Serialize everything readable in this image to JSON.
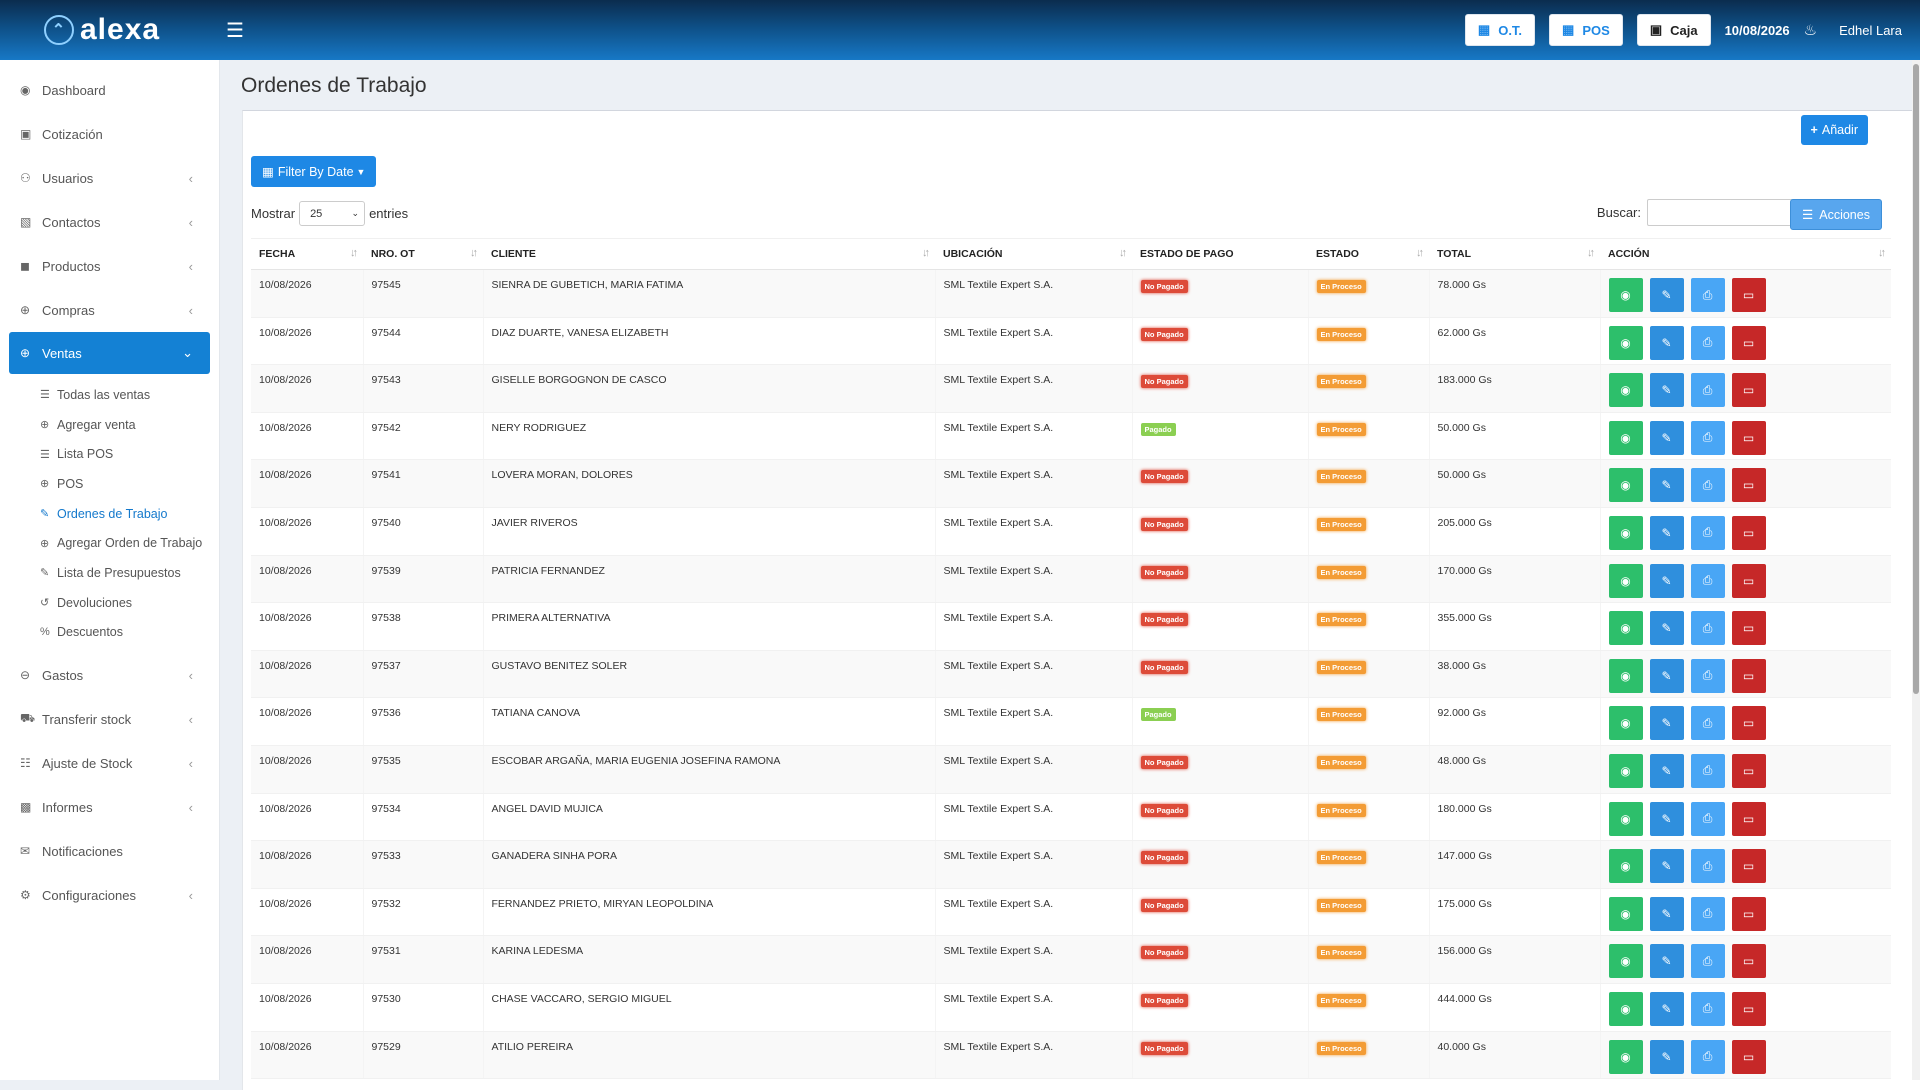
{
  "header": {
    "brand": "alexa",
    "buttons": [
      {
        "label": "O.T.",
        "icon": "grid-icon"
      },
      {
        "label": "POS",
        "icon": "grid-icon"
      },
      {
        "label": "Caja",
        "icon": "cash-icon"
      }
    ],
    "date": "10/08/2026",
    "user": "Edhel Lara"
  },
  "sidebar": {
    "items": [
      {
        "label": "Dashboard",
        "icon": "dashboard-icon"
      },
      {
        "label": "Cotización",
        "icon": "money-icon"
      },
      {
        "label": "Usuarios",
        "icon": "users-icon"
      },
      {
        "label": "Contactos",
        "icon": "contacts-icon"
      },
      {
        "label": "Productos",
        "icon": "cubes-icon"
      },
      {
        "label": "Compras",
        "icon": "plus-circle-icon"
      },
      {
        "label": "Ventas",
        "icon": "plus-circle-icon"
      },
      {
        "label": "Gastos",
        "icon": "minus-circle-icon"
      },
      {
        "label": "Transferir stock",
        "icon": "truck-icon"
      },
      {
        "label": "Ajuste de Stock",
        "icon": "database-icon"
      },
      {
        "label": "Informes",
        "icon": "bar-chart-icon"
      },
      {
        "label": "Notificaciones",
        "icon": "envelope-icon"
      },
      {
        "label": "Configuraciones",
        "icon": "gear-icon"
      }
    ],
    "ventas_sub": [
      {
        "label": "Todas las ventas",
        "icon": "list-icon"
      },
      {
        "label": "Agregar venta",
        "icon": "plus-circle-icon"
      },
      {
        "label": "Lista POS",
        "icon": "list-icon"
      },
      {
        "label": "POS",
        "icon": "plus-circle-icon"
      },
      {
        "label": "Ordenes de Trabajo",
        "icon": "edit-icon"
      },
      {
        "label": "Agregar Orden de Trabajo",
        "icon": "plus-circle-icon"
      },
      {
        "label": "Lista de Presupuestos",
        "icon": "edit-icon"
      },
      {
        "label": "Devoluciones",
        "icon": "undo-icon"
      },
      {
        "label": "Descuentos",
        "icon": "percent-icon"
      }
    ]
  },
  "page": {
    "title": "Ordenes de Trabajo",
    "add_label": "Añadir",
    "filter_label": "Filter By Date",
    "show_label": "Mostrar",
    "entries_value": "25",
    "entries_label": "entries",
    "search_label": "Buscar:",
    "search_value": "",
    "actions_label": "Acciones"
  },
  "table": {
    "headers": [
      "Fecha",
      "Nro. OT",
      "Cliente",
      "Ubicación",
      "Estado de pago",
      "Estado",
      "Total",
      "Acción"
    ],
    "rows": [
      [
        "10/08/2026",
        "97545",
        "SIENRA DE GUBETICH, MARIA FATIMA",
        "SML Textile Expert S.A.",
        "No Pagado",
        "En Proceso",
        "78.000 Gs"
      ],
      [
        "10/08/2026",
        "97544",
        "DIAZ DUARTE, VANESA ELIZABETH",
        "SML Textile Expert S.A.",
        "No Pagado",
        "En Proceso",
        "62.000 Gs"
      ],
      [
        "10/08/2026",
        "97543",
        "GISELLE BORGOGNON DE CASCO",
        "SML Textile Expert S.A.",
        "No Pagado",
        "En Proceso",
        "183.000 Gs"
      ],
      [
        "10/08/2026",
        "97542",
        "NERY RODRIGUEZ",
        "SML Textile Expert S.A.",
        "Pagado",
        "En Proceso",
        "50.000 Gs"
      ],
      [
        "10/08/2026",
        "97541",
        "LOVERA MORAN, DOLORES",
        "SML Textile Expert S.A.",
        "No Pagado",
        "En Proceso",
        "50.000 Gs"
      ],
      [
        "10/08/2026",
        "97540",
        "JAVIER RIVEROS",
        "SML Textile Expert S.A.",
        "No Pagado",
        "En Proceso",
        "205.000 Gs"
      ],
      [
        "10/08/2026",
        "97539",
        "PATRICIA FERNANDEZ",
        "SML Textile Expert S.A.",
        "No Pagado",
        "En Proceso",
        "170.000 Gs"
      ],
      [
        "10/08/2026",
        "97538",
        "PRIMERA ALTERNATIVA",
        "SML Textile Expert S.A.",
        "No Pagado",
        "En Proceso",
        "355.000 Gs"
      ],
      [
        "10/08/2026",
        "97537",
        "GUSTAVO BENITEZ SOLER",
        "SML Textile Expert S.A.",
        "No Pagado",
        "En Proceso",
        "38.000 Gs"
      ],
      [
        "10/08/2026",
        "97536",
        "TATIANA CANOVA",
        "SML Textile Expert S.A.",
        "Pagado",
        "En Proceso",
        "92.000 Gs"
      ],
      [
        "10/08/2026",
        "97535",
        "ESCOBAR ARGAÑA, MARIA EUGENIA JOSEFINA RAMONA",
        "SML Textile Expert S.A.",
        "No Pagado",
        "En Proceso",
        "48.000 Gs"
      ],
      [
        "10/08/2026",
        "97534",
        "ANGEL DAVID MUJICA",
        "SML Textile Expert S.A.",
        "No Pagado",
        "En Proceso",
        "180.000 Gs"
      ],
      [
        "10/08/2026",
        "97533",
        "GANADERA SINHA PORA",
        "SML Textile Expert S.A.",
        "No Pagado",
        "En Proceso",
        "147.000 Gs"
      ],
      [
        "10/08/2026",
        "97532",
        "FERNANDEZ PRIETO, MIRYAN LEOPOLDINA",
        "SML Textile Expert S.A.",
        "No Pagado",
        "En Proceso",
        "175.000 Gs"
      ],
      [
        "10/08/2026",
        "97531",
        "KARINA LEDESMA",
        "SML Textile Expert S.A.",
        "No Pagado",
        "En Proceso",
        "156.000 Gs"
      ],
      [
        "10/08/2026",
        "97530",
        "CHASE VACCARO, SERGIO MIGUEL",
        "SML Textile Expert S.A.",
        "No Pagado",
        "En Proceso",
        "444.000 Gs"
      ],
      [
        "10/08/2026",
        "97529",
        "ATILIO PEREIRA",
        "SML Textile Expert S.A.",
        "No Pagado",
        "En Proceso",
        "40.000 Gs"
      ]
    ]
  },
  "colors": {
    "primary": "#1e88e5",
    "no_pagado": "#dd4b39",
    "pagado": "#8bcf52",
    "en_proceso": "#f39c35",
    "view": "#2dbf6b",
    "edit": "#2f8fdd",
    "print": "#49a6f5",
    "delete": "#c62828"
  }
}
